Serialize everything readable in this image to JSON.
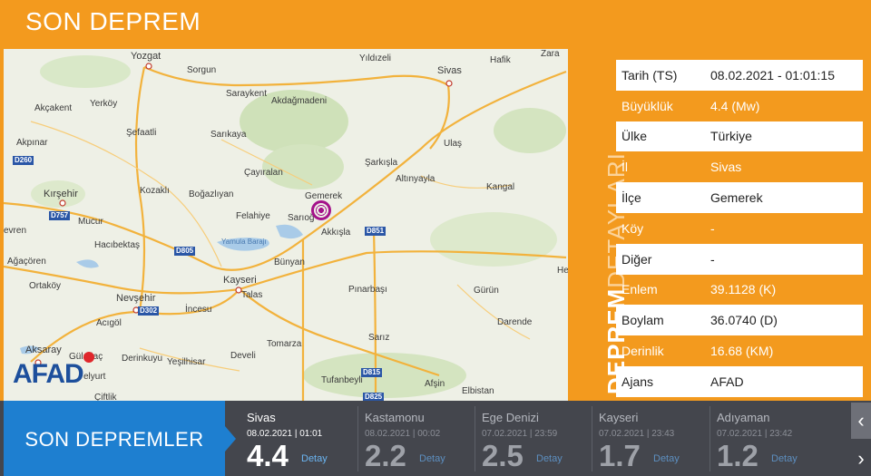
{
  "header": {
    "title": "SON DEPREM"
  },
  "map": {
    "logo": "AFAD",
    "labels": [
      {
        "text": "Yozgat"
      },
      {
        "text": "Sorgun"
      },
      {
        "text": "Yıldızeli"
      },
      {
        "text": "Sivas"
      },
      {
        "text": "Hafik"
      },
      {
        "text": "Zara"
      },
      {
        "text": "Akçakent"
      },
      {
        "text": "Yerköy"
      },
      {
        "text": "Saraykent"
      },
      {
        "text": "Akdağmadeni"
      },
      {
        "text": "Akpınar"
      },
      {
        "text": "Şefaatli"
      },
      {
        "text": "Sarıkaya"
      },
      {
        "text": "Ulaş"
      },
      {
        "text": "Şarkışla"
      },
      {
        "text": "Çayıralan"
      },
      {
        "text": "Altınyayla"
      },
      {
        "text": "Kırşehir"
      },
      {
        "text": "Kozaklı"
      },
      {
        "text": "Boğazlıyan"
      },
      {
        "text": "Gemerek"
      },
      {
        "text": "Kangal"
      },
      {
        "text": "Felahiye"
      },
      {
        "text": "Sarıoğ"
      },
      {
        "text": "Mucur"
      },
      {
        "text": "Akkışla"
      },
      {
        "text": "evren"
      },
      {
        "text": "Hacıbektaş"
      },
      {
        "text": "Yamula Barajı"
      },
      {
        "text": "Ağaçören"
      },
      {
        "text": "Bünyan"
      },
      {
        "text": "He"
      },
      {
        "text": "Ortaköy"
      },
      {
        "text": "Kayseri"
      },
      {
        "text": "Talas"
      },
      {
        "text": "Nevşehir"
      },
      {
        "text": "Pınarbaşı"
      },
      {
        "text": "Gürün"
      },
      {
        "text": "İncesu"
      },
      {
        "text": "Acıgöl"
      },
      {
        "text": "Darende"
      },
      {
        "text": "Tomarza"
      },
      {
        "text": "Aksaray"
      },
      {
        "text": "Gülağaç"
      },
      {
        "text": "Derinkuyu"
      },
      {
        "text": "Yeşilhisar"
      },
      {
        "text": "Develi"
      },
      {
        "text": "Sarız"
      },
      {
        "text": "elyurt"
      },
      {
        "text": "Tufanbeyli"
      },
      {
        "text": "Afşin"
      },
      {
        "text": "Elbistan"
      },
      {
        "text": "Çiftlik"
      }
    ],
    "roads": [
      "D260",
      "D757",
      "D805",
      "D851",
      "D302",
      "D815",
      "D825"
    ]
  },
  "side_caption": {
    "bold": "DEPREM",
    "thin": "DETAYLARI"
  },
  "details": [
    {
      "label": "Tarih (TS)",
      "value": "08.02.2021 - 01:01:15"
    },
    {
      "label": "Büyüklük",
      "value": "4.4 (Mw)"
    },
    {
      "label": "Ülke",
      "value": "Türkiye"
    },
    {
      "label": "İl",
      "value": "Sivas"
    },
    {
      "label": "İlçe",
      "value": "Gemerek"
    },
    {
      "label": "Köy",
      "value": "-"
    },
    {
      "label": "Diğer",
      "value": "-"
    },
    {
      "label": "Enlem",
      "value": "39.1128 (K)"
    },
    {
      "label": "Boylam",
      "value": "36.0740 (D)"
    },
    {
      "label": "Derinlik",
      "value": "16.68 (KM)"
    },
    {
      "label": "Ajans",
      "value": "AFAD"
    }
  ],
  "recent": {
    "title": "SON DEPREMLER",
    "items": [
      {
        "place": "Sivas",
        "time": "08.02.2021 | 01:01",
        "mag": "4.4",
        "detail": "Detay"
      },
      {
        "place": "Kastamonu",
        "time": "08.02.2021 | 00:02",
        "mag": "2.2",
        "detail": "Detay"
      },
      {
        "place": "Ege Denizi",
        "time": "07.02.2021 | 23:59",
        "mag": "2.5",
        "detail": "Detay"
      },
      {
        "place": "Kayseri",
        "time": "07.02.2021 | 23:43",
        "mag": "1.7",
        "detail": "Detay"
      },
      {
        "place": "Adıyaman",
        "time": "07.02.2021 | 23:42",
        "mag": "1.2",
        "detail": "Detay"
      }
    ],
    "prev": "‹",
    "next": "›"
  },
  "colors": {
    "brand_orange": "#f39a1e",
    "panel_blue": "#1e7fd0",
    "bar_gray": "#44464d",
    "epicenter": "#a4128a"
  }
}
